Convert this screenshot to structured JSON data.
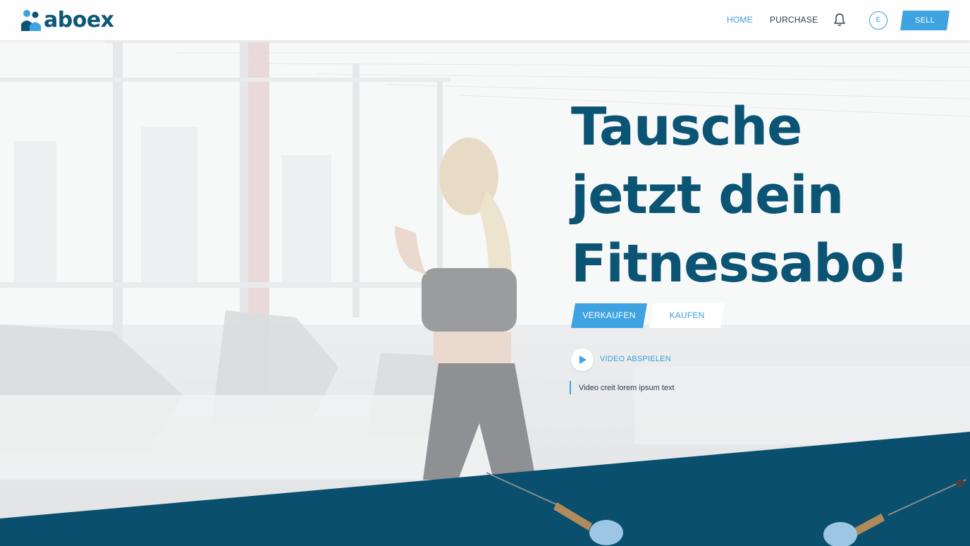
{
  "app": {
    "logo_text": "aboex"
  },
  "nav": {
    "home": "HOME",
    "purchase": "PURCHASE",
    "bell_icon": "bell-icon",
    "avatar_initial": "E",
    "sell": "SELL"
  },
  "hero": {
    "headline_lines": [
      "Tausche",
      "jetzt dein",
      "Fitnessabo!"
    ],
    "sell_button": "VERKAUFEN",
    "buy_button": "KAUFEN",
    "video_label": "VIDEO ABSPIELEN",
    "video_icon": "play-icon",
    "credit": "Video creit lorem ipsum text"
  },
  "colors": {
    "brand_dark": "#0b5474",
    "accent": "#3ea3e0",
    "band": "#0a4f6d"
  }
}
